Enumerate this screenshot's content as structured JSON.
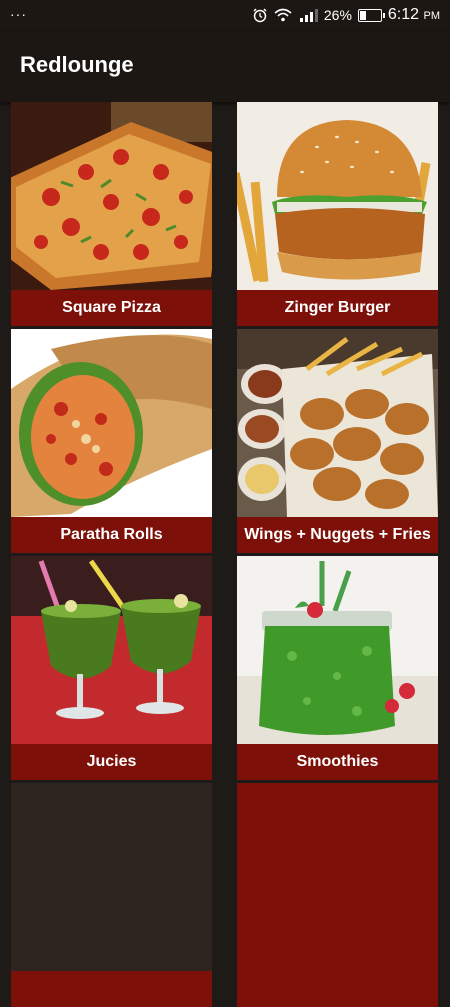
{
  "status_bar": {
    "menu_dots": "···",
    "battery": "26%",
    "battery_level": 0.26,
    "time": "6:12",
    "ampm": "PM",
    "icons": [
      "alarm-icon",
      "wifi-icon",
      "signal-icon",
      "battery-icon"
    ]
  },
  "app": {
    "title": "Redlounge"
  },
  "menu": {
    "items": [
      {
        "label": "Square Pizza"
      },
      {
        "label": "Zinger Burger"
      },
      {
        "label": "Paratha Rolls"
      },
      {
        "label": "Wings + Nuggets + Fries"
      },
      {
        "label": "Jucies"
      },
      {
        "label": "Smoothies"
      }
    ]
  },
  "colors": {
    "card_label_bg": "#7d1109",
    "background": "#1e1a18",
    "bar": "#1c1713"
  }
}
